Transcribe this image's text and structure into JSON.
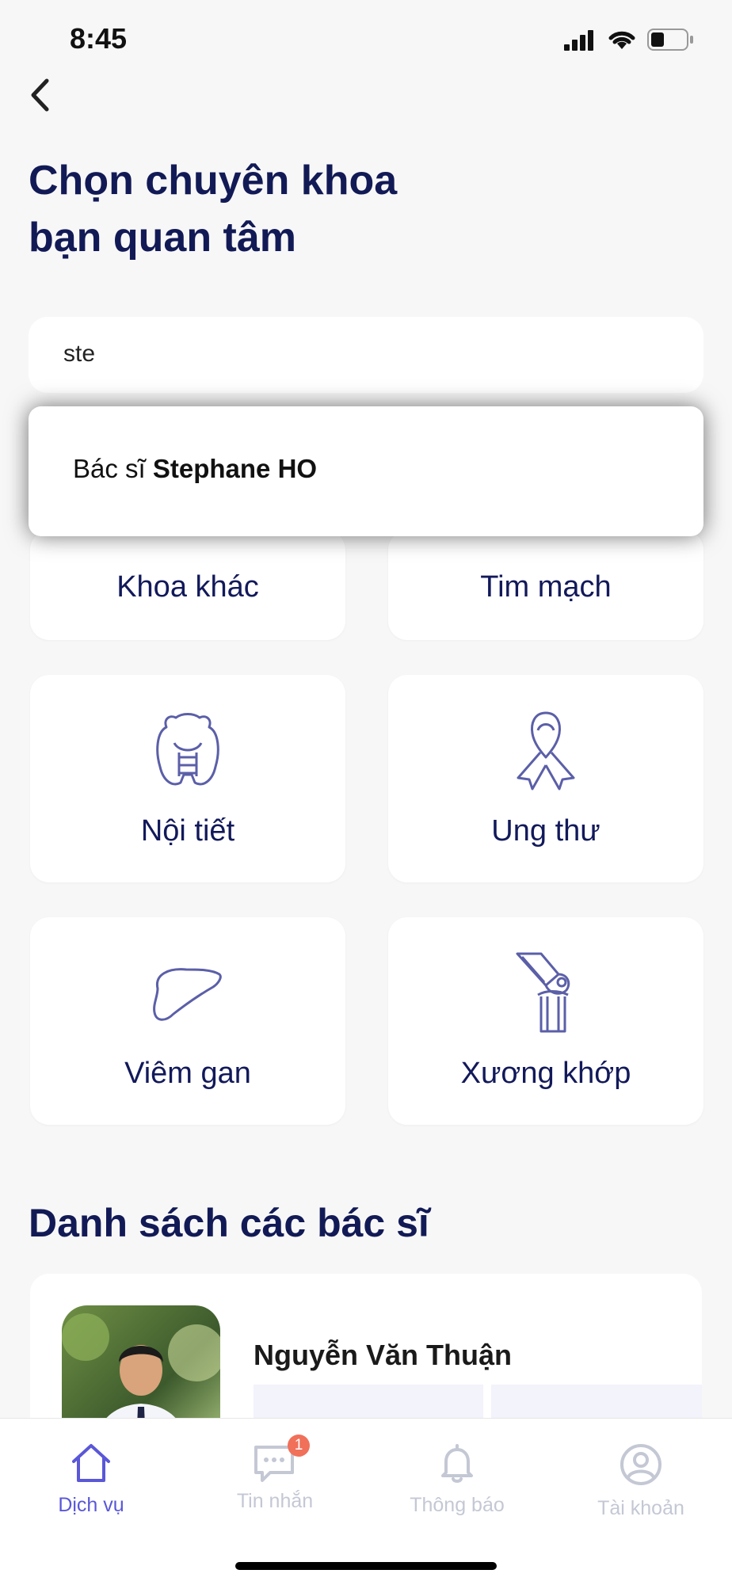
{
  "status_bar": {
    "time": "8:45"
  },
  "page": {
    "title_line1": "Chọn chuyên khoa",
    "title_line2": "bạn quan tâm"
  },
  "search": {
    "value": "ste"
  },
  "suggestion": {
    "prefix": "Bác sĩ ",
    "name": "Stephane HO"
  },
  "specialties": [
    {
      "label": "Khoa khác",
      "icon": "other-icon"
    },
    {
      "label": "Tim mạch",
      "icon": "heart-icon"
    },
    {
      "label": "Nội tiết",
      "icon": "thyroid-icon"
    },
    {
      "label": "Ung thư",
      "icon": "ribbon-icon"
    },
    {
      "label": "Viêm gan",
      "icon": "liver-icon"
    },
    {
      "label": "Xương khớp",
      "icon": "knee-joint-icon"
    }
  ],
  "doctors_section": {
    "title": "Danh sách các bác sĩ"
  },
  "doctors": [
    {
      "name": "Nguyễn Văn Thuận"
    }
  ],
  "tabbar": {
    "items": [
      {
        "label": "Dịch vụ",
        "icon": "home-icon",
        "active": true
      },
      {
        "label": "Tin nhắn",
        "icon": "chat-icon",
        "badge": "1"
      },
      {
        "label": "Thông báo",
        "icon": "bell-icon"
      },
      {
        "label": "Tài khoản",
        "icon": "account-icon"
      }
    ]
  },
  "colors": {
    "primary": "#121a56",
    "accent": "#5a57d8",
    "inactive": "#c4c8d4",
    "badge": "#f0705a",
    "icon_stroke": "#5b5fa8"
  }
}
